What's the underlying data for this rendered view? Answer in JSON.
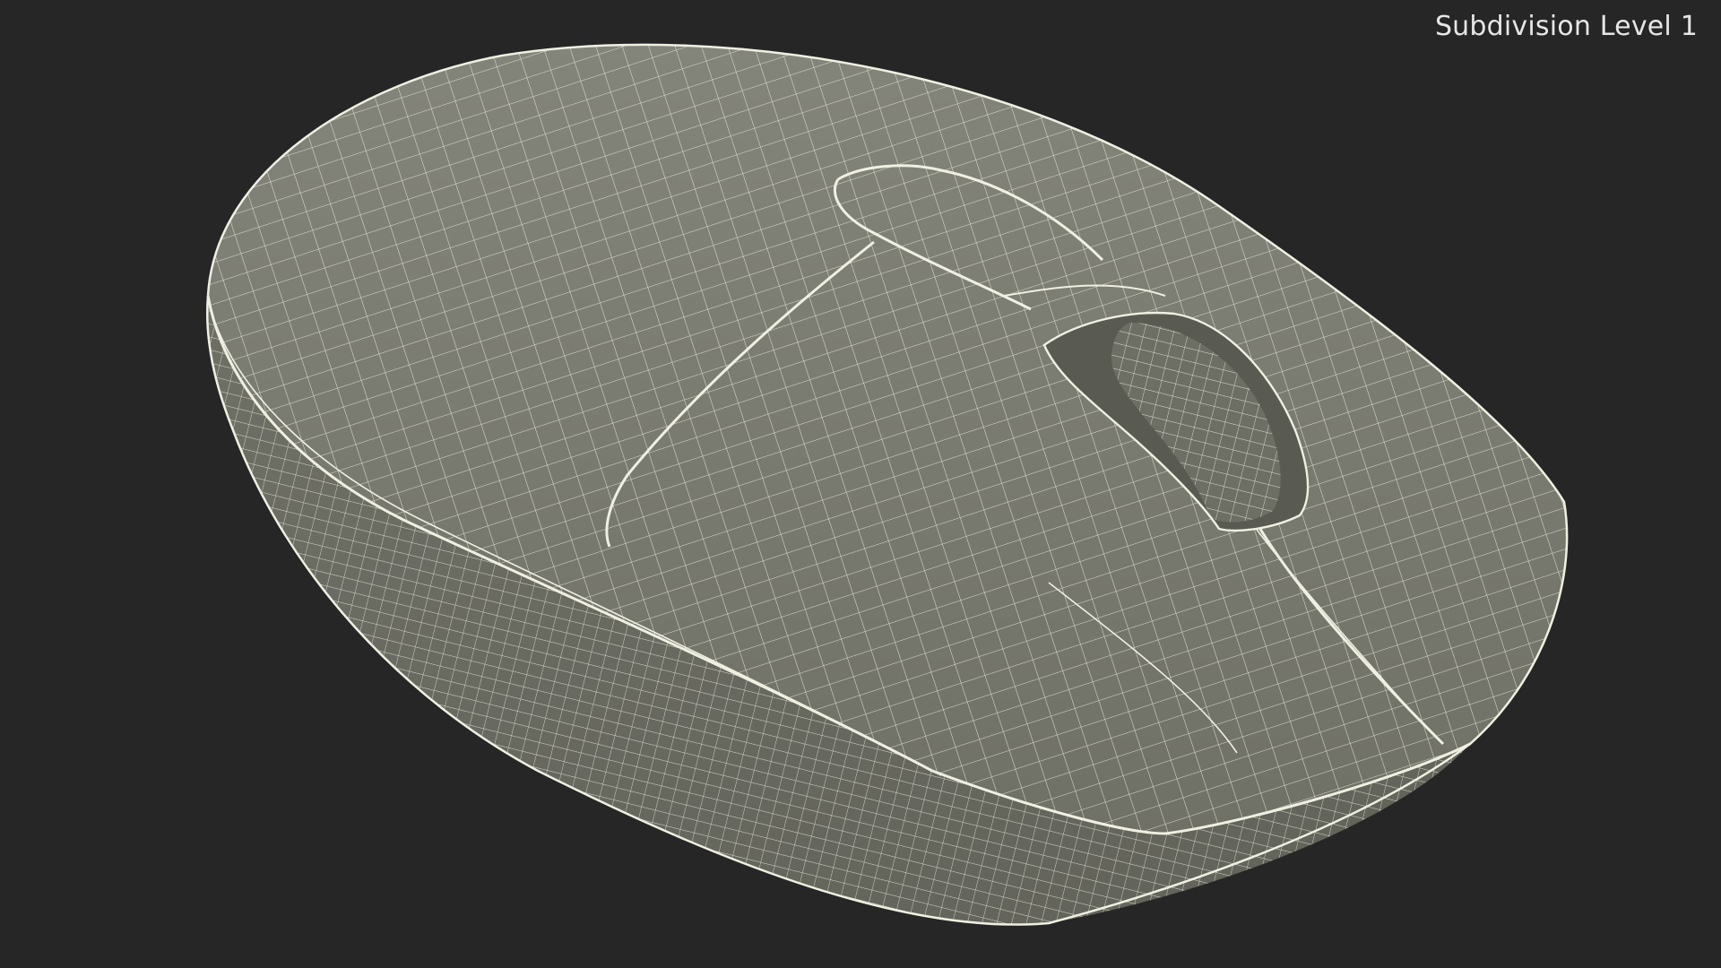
{
  "overlay": {
    "label": "Subdivision Level 1"
  },
  "colors": {
    "background": "#262626",
    "mesh_fill": "#797a6f",
    "wire": "#efefe2",
    "shadow": "#4a4b44"
  },
  "subject": {
    "icon": "computer-mouse-wireframe"
  }
}
